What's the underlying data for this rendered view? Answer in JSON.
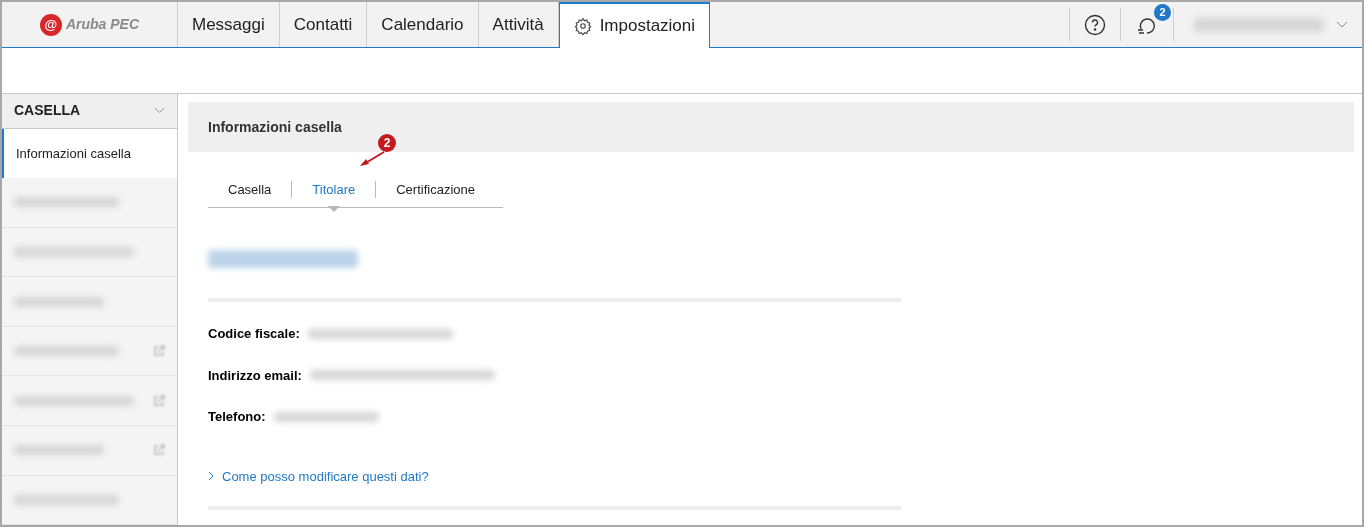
{
  "logo": {
    "mark": "@",
    "text": "Aruba PEC"
  },
  "nav_tabs": [
    {
      "label": "Messaggi",
      "selected": false,
      "icon": false
    },
    {
      "label": "Contatti",
      "selected": false,
      "icon": false
    },
    {
      "label": "Calendario",
      "selected": false,
      "icon": false
    },
    {
      "label": "Attività",
      "selected": false,
      "icon": false
    },
    {
      "label": "Impostazioni",
      "selected": true,
      "icon": true
    }
  ],
  "notifications": {
    "count": "2"
  },
  "sidebar": {
    "section": "CASELLA",
    "expanded": true,
    "items": [
      {
        "label": "Informazioni casella",
        "selected": true,
        "redacted": false,
        "external": false
      },
      {
        "redacted": true,
        "selected": false,
        "external": false
      },
      {
        "redacted": true,
        "selected": false,
        "external": false
      },
      {
        "redacted": true,
        "selected": false,
        "external": false
      },
      {
        "redacted": true,
        "selected": false,
        "external": true
      },
      {
        "redacted": true,
        "selected": false,
        "external": true
      },
      {
        "redacted": true,
        "selected": false,
        "external": true
      },
      {
        "redacted": true,
        "selected": false,
        "external": false
      }
    ]
  },
  "content": {
    "title": "Informazioni casella",
    "sub_tabs": [
      {
        "label": "Casella",
        "selected": false
      },
      {
        "label": "Titolare",
        "selected": true
      },
      {
        "label": "Certificazione",
        "selected": false
      }
    ],
    "annotation": {
      "number": "2"
    },
    "fields": [
      {
        "label": "Codice fiscale:"
      },
      {
        "label": "Indirizzo email:"
      },
      {
        "label": "Telefono:"
      }
    ],
    "help_link": "Come posso modificare questi dati?"
  }
}
